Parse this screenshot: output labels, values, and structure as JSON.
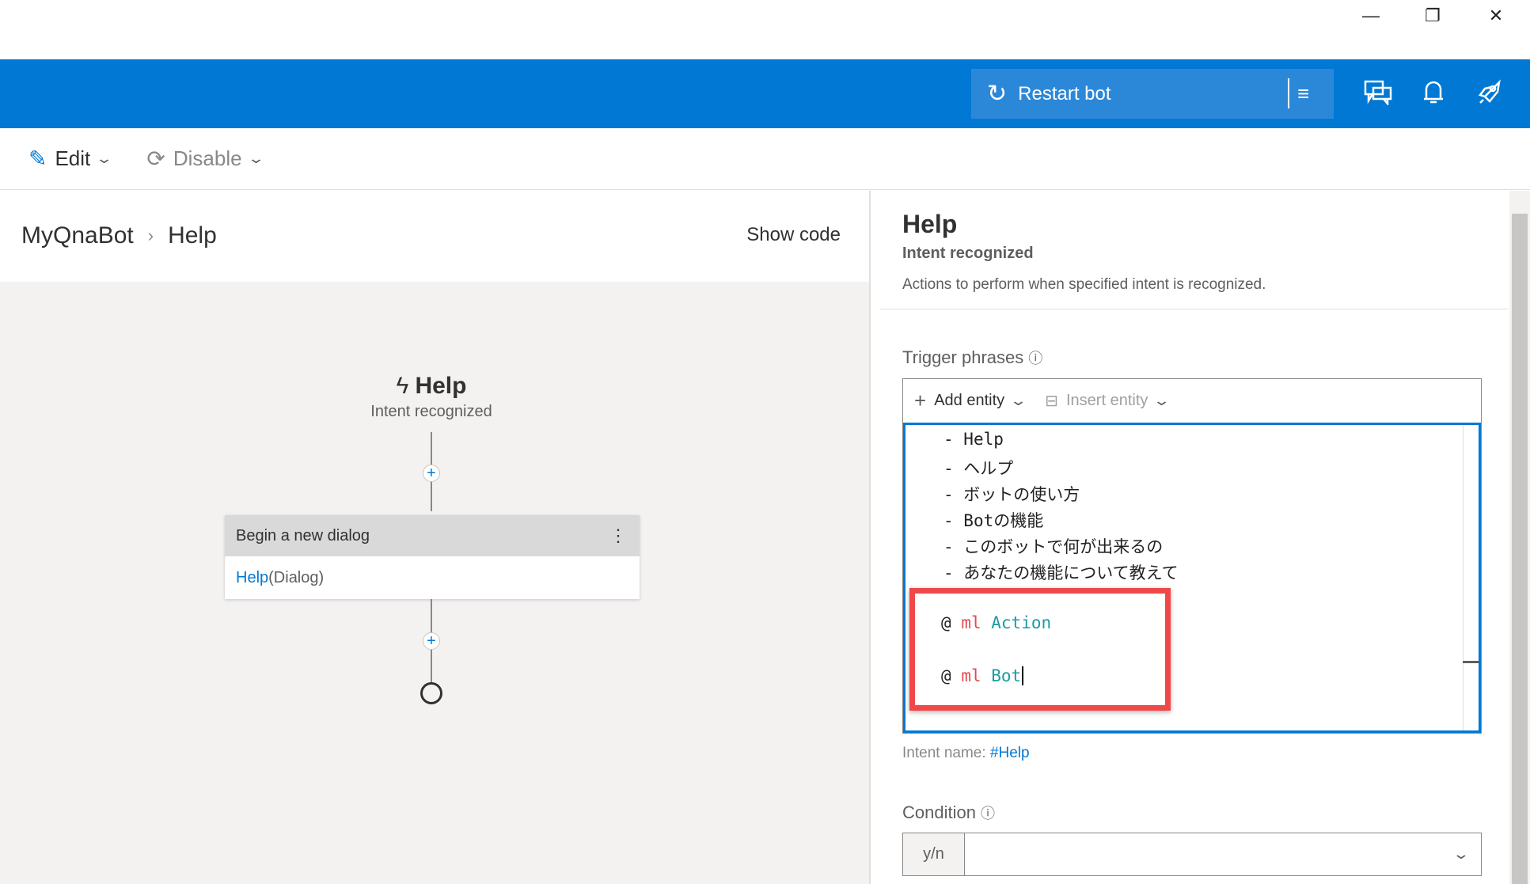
{
  "window": {
    "minimize": "—",
    "restore": "❐",
    "close": "✕"
  },
  "header": {
    "restart_label": "Restart bot",
    "icons": [
      "restart-icon",
      "menu-icon",
      "chat-icon",
      "bell-icon",
      "rocket-icon"
    ],
    "accent": "#0078d4"
  },
  "toolbar": {
    "edit_label": "Edit",
    "disable_label": "Disable"
  },
  "breadcrumb": {
    "root": "MyQnaBot",
    "current": "Help",
    "show_code": "Show code"
  },
  "flow": {
    "trigger_title": "Help",
    "trigger_subtitle": "Intent recognized",
    "card_title": "Begin a new dialog",
    "card_link": "Help",
    "card_suffix": " (Dialog)"
  },
  "panel": {
    "title": "Help",
    "subtitle": "Intent recognized",
    "description": "Actions to perform when specified intent is recognized.",
    "trigger_label": "Trigger phrases",
    "add_entity": "Add entity",
    "insert_entity": "Insert entity",
    "phrases": [
      "Help",
      "ヘルプ",
      "ボットの使い方",
      "Botの機能",
      "このボットで何が出来るの",
      "あなたの機能について教えて"
    ],
    "entities": [
      {
        "at": "@",
        "type": "ml",
        "name": "Action"
      },
      {
        "at": "@",
        "type": "ml",
        "name": "Bot"
      }
    ],
    "intent_label": "Intent name: ",
    "intent_value": "#Help",
    "condition_label": "Condition",
    "condition_prefix": "y/n",
    "condition_value": ""
  }
}
